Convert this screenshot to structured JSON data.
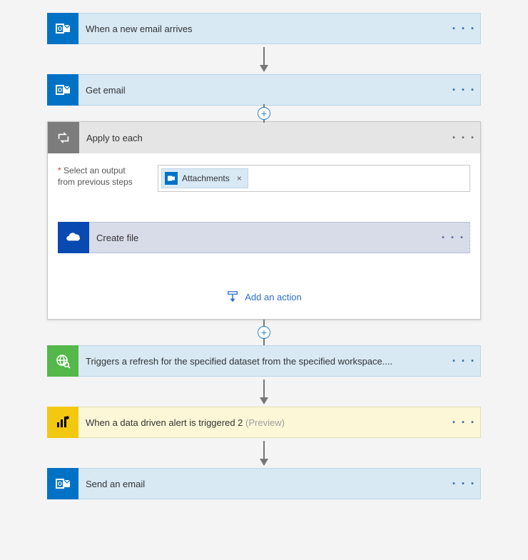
{
  "steps": {
    "s1": {
      "title": "When a new email arrives"
    },
    "s2": {
      "title": "Get email"
    },
    "container": {
      "title": "Apply to each",
      "field_label_prefix": "*",
      "field_label_line1": "Select an output",
      "field_label_line2": "from previous steps",
      "token": {
        "label": "Attachments",
        "remove": "×"
      },
      "inner_step": {
        "title": "Create file"
      },
      "add_action": "Add an action"
    },
    "s3": {
      "title": "Triggers a refresh for the specified dataset from the specified workspace...."
    },
    "s4": {
      "title": "When a data driven alert is triggered 2 ",
      "preview": "(Preview)"
    },
    "s5": {
      "title": "Send an email"
    }
  },
  "glyphs": {
    "dots": "· · ·",
    "plus": "+"
  }
}
